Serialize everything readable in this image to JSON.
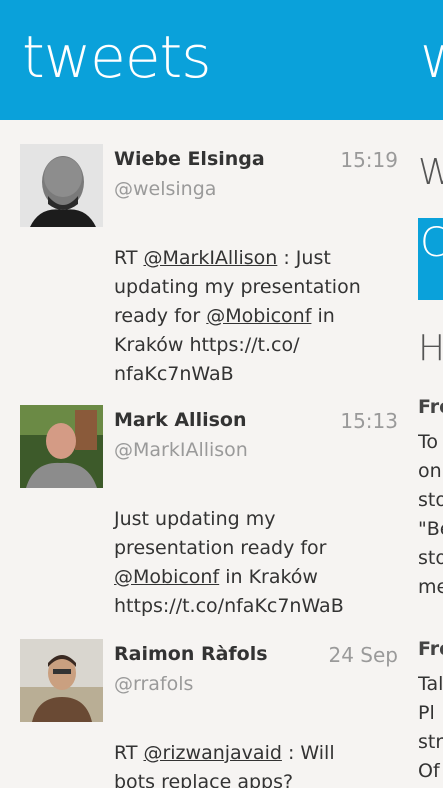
{
  "header": {
    "title": "tweets",
    "next_title": "w"
  },
  "colors": {
    "accent": "#0aa1da",
    "background": "#f6f4f2"
  },
  "tweets": [
    {
      "name": "Wiebe Elsinga",
      "handle": "@welsinga",
      "time": "15:19",
      "segments": [
        {
          "text": "RT ",
          "mention": false
        },
        {
          "text": "@MarkIAllison",
          "mention": true
        },
        {
          "text": " : Just updating my presentation ready for ",
          "mention": false
        },
        {
          "text": "@Mobiconf",
          "mention": true
        },
        {
          "text": " in Kraków https://t.co/ nfaKc7nWaB",
          "mention": false
        }
      ]
    },
    {
      "name": "Mark Allison",
      "handle": "@MarkIAllison",
      "time": "15:13",
      "segments": [
        {
          "text": "Just updating my presentation ready for ",
          "mention": false
        },
        {
          "text": "@Mobiconf",
          "mention": true
        },
        {
          "text": " in Kraków https://t.co/nfaKc7nWaB",
          "mention": false
        }
      ]
    },
    {
      "name": "Raimon Ràfols",
      "handle": "@rrafols",
      "time": "24 Sep",
      "segments": [
        {
          "text": "RT ",
          "mention": false
        },
        {
          "text": "@rizwanjavaid",
          "mention": true
        },
        {
          "text": " : Will bots replace apps? Looking",
          "mention": false
        }
      ]
    }
  ],
  "right_panel": {
    "heading": "W",
    "block_char": "C",
    "subheading": "H",
    "section1_title": "Fro",
    "section1_lines": [
      "To",
      "on",
      "sto",
      "\"Be",
      "sto",
      "me"
    ],
    "section2_title": "Fro",
    "section2_lines": [
      "Tal",
      "Pl",
      "str",
      "Of"
    ]
  }
}
